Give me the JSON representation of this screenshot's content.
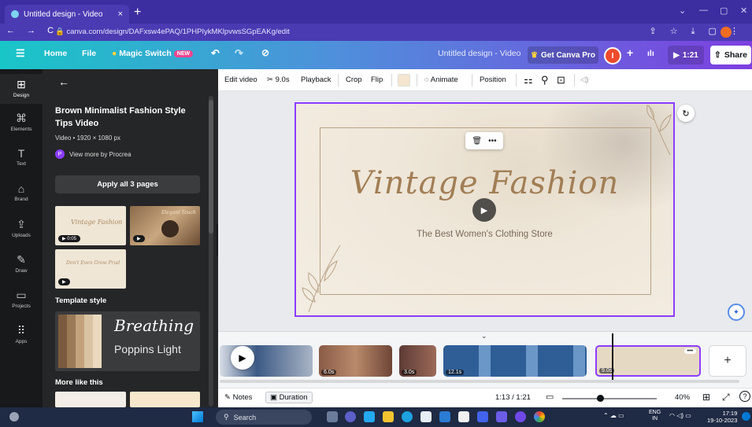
{
  "browser": {
    "tab_title": "Untitled design - Video",
    "tab_close": "×",
    "new_tab": "+",
    "url": "canva.com/design/DAFxsw4ePAQ/1PHPIykMKlpvwsSGpEAKg/edit",
    "nav_glyphs": "← → C",
    "right_glyphs": "⇪ ☆ ⤓ ▢ ⋮",
    "win_controls": [
      "⌄",
      "—",
      "▢",
      "✕"
    ]
  },
  "topbar": {
    "menu_icon": "☰",
    "home": "Home",
    "file": "File",
    "magic_switch": "Magic Switch",
    "new_badge": "NEW",
    "undo": "↶",
    "redo": "↷",
    "sync": "⊘",
    "doc_title": "Untitled design - Video",
    "get_pro": "Get Canva Pro",
    "avatar_letter": "I",
    "plus": "+",
    "insights": "ılı",
    "duration": "1:21",
    "share": "Share"
  },
  "rail": [
    {
      "label": "Design",
      "icon": "⊞"
    },
    {
      "label": "Elements",
      "icon": "⌘"
    },
    {
      "label": "Text",
      "icon": "T"
    },
    {
      "label": "Brand",
      "icon": "⌂"
    },
    {
      "label": "Uploads",
      "icon": "⇪"
    },
    {
      "label": "Draw",
      "icon": "✎"
    },
    {
      "label": "Projects",
      "icon": "▭"
    },
    {
      "label": "Apps",
      "icon": "⠿"
    }
  ],
  "panel": {
    "back": "←",
    "title": "Brown Minimalist Fashion Style Tips Video",
    "meta": "Video • 1920 × 1080 px",
    "author_initial": "P",
    "author": "View more by Procrea",
    "apply_all": "Apply all 3 pages",
    "thumbs": [
      {
        "duration": "▶ 0:05",
        "script": "Vintage Fashion"
      },
      {
        "duration": "▶",
        "script": "Elegant Touch"
      },
      {
        "duration": "▶",
        "script": "Don't Even Grow Prud"
      }
    ],
    "template_style_heading": "Template style",
    "font_script": "Breathing",
    "font_sans": "Poppins Light",
    "swatches": [
      "#7a5a3e",
      "#9b7a58",
      "#c2a27c",
      "#d9c3a3",
      "#ead9bf"
    ],
    "more_like_this": "More like this",
    "collapse_glyph": "‹"
  },
  "toolbar": {
    "edit_video": "Edit video",
    "split": "9.0s",
    "playback": "Playback",
    "crop": "Crop",
    "flip": "Flip",
    "animate": "Animate",
    "position": "Position",
    "transparency": "⚏",
    "link": "⚲",
    "lock": "⊡",
    "volume": "◁)"
  },
  "canvas": {
    "title": "Vintage Fashion",
    "subtitle": "The Best Women's Clothing Store",
    "delete_glyph": "🗑",
    "more_glyph": "•••",
    "play_glyph": "▶",
    "rotate_glyph": "↻",
    "magic_glyph": "✦",
    "expand_glyph": "⌄"
  },
  "timeline": {
    "play_glyph": "▶",
    "add_glyph": "+",
    "clips": [
      {
        "duration": "",
        "color": "#3c5a85"
      },
      {
        "duration": "6.0s",
        "color": "#8a5b47"
      },
      {
        "duration": "3.0s",
        "color": "#5d3a36"
      },
      {
        "duration": "12.1s",
        "color": "#2f5e96"
      },
      {
        "duration": "9.0s",
        "color": "#e6d9c4"
      }
    ],
    "clip_more": "•••"
  },
  "bottombar": {
    "notes": "Notes",
    "duration": "Duration",
    "time": "1:13 / 1:21",
    "zoom": "40%",
    "grid_glyph": "⊞",
    "fullscreen_glyph": "⤢",
    "help_glyph": "?"
  },
  "taskbar": {
    "search": "Search",
    "lang": "ENG",
    "region": "IN",
    "time": "17:19",
    "date": "19-10-2023",
    "tray_glyphs": "⌃ ☁ ▭",
    "wifi_sound": "◠ ◁) ▭"
  },
  "colors": {
    "canva_purple": "#8b3dff",
    "browser": "#3c2ea0",
    "panel_dark": "#252627",
    "title_brown": "#a27e55"
  }
}
